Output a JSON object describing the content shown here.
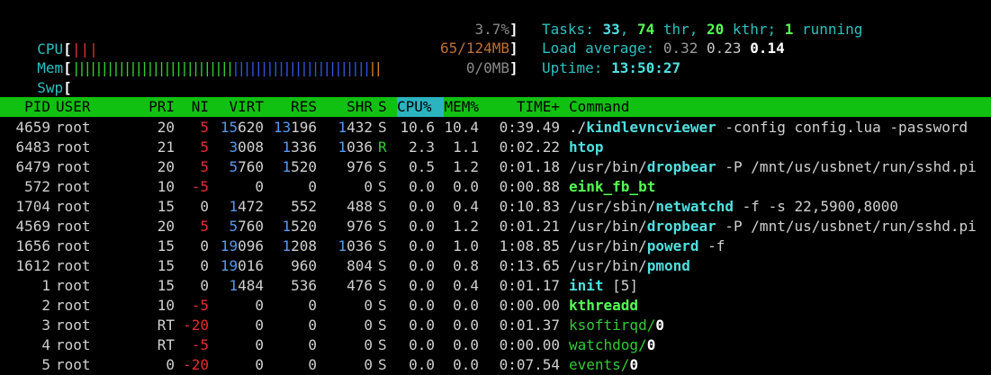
{
  "meters": {
    "cpu": {
      "label": "CPU",
      "bar": "|||",
      "value": "3.7%",
      "percent": 3.7
    },
    "mem": {
      "label": "Mem",
      "bar_green": "||||||||||||||||||||||||||||",
      "bar_blue": "||||||||||||||||||||||||",
      "bar_orange": "||",
      "value": "65/124MB"
    },
    "swp": {
      "label": "Swp",
      "value": "0/0MB"
    },
    "open_bracket": "[",
    "close_bracket": "]"
  },
  "summary": {
    "tasks_label": "Tasks: ",
    "tasks": "33",
    "sep1": ", ",
    "threads": "74",
    "thr_label": " thr, ",
    "kthreads": "20",
    "kthr_label": " kthr; ",
    "running": "1",
    "running_label": " running",
    "load_label": "Load average: ",
    "load1": "0.32",
    "load5": "0.23",
    "load15": "0.14",
    "uptime_label": "Uptime: ",
    "uptime": "13:50:27"
  },
  "columns": {
    "pid": "PID",
    "user": "USER",
    "pri": "PRI",
    "ni": "NI",
    "virt": "VIRT",
    "res": "RES",
    "shr": "SHR",
    "s": "S",
    "cpu": "CPU%",
    "mem": "MEM%",
    "time": "TIME+",
    "command": "Command"
  },
  "processes": [
    {
      "pid": "4659",
      "user": "root",
      "pri": "20",
      "ni": "5",
      "virt_hi": "15",
      "virt_lo": "620",
      "res_hi": "13",
      "res_lo": "196",
      "shr_hi": "1",
      "shr_lo": "432",
      "s": "S",
      "cpu": "10.6",
      "mem": "10.4",
      "time": "0:39.49",
      "cmd_pre": "./",
      "cmd_bin": "kindlevncviewer",
      "cmd_args": " -config config.lua -password"
    },
    {
      "pid": "6483",
      "user": "root",
      "pri": "21",
      "ni": "5",
      "virt_hi": "3",
      "virt_lo": "008",
      "res_hi": "1",
      "res_lo": "336",
      "shr_hi": "1",
      "shr_lo": "036",
      "s": "R",
      "cpu": "2.3",
      "mem": "1.1",
      "time": "0:02.22",
      "cmd_pre": "",
      "cmd_bin": "htop",
      "cmd_args": ""
    },
    {
      "pid": "6479",
      "user": "root",
      "pri": "20",
      "ni": "5",
      "virt_hi": "5",
      "virt_lo": "760",
      "res_hi": "1",
      "res_lo": "520",
      "shr_hi": "",
      "shr_lo": "976",
      "s": "S",
      "cpu": "0.5",
      "mem": "1.2",
      "time": "0:01.18",
      "cmd_pre": "/usr/bin/",
      "cmd_bin": "dropbear",
      "cmd_args": " -P /mnt/us/usbnet/run/sshd.pi"
    },
    {
      "pid": "572",
      "user": "root",
      "pri": "10",
      "ni": "-5",
      "virt_hi": "",
      "virt_lo": "0",
      "res_hi": "",
      "res_lo": "0",
      "shr_hi": "",
      "shr_lo": "0",
      "s": "S",
      "cpu": "0.0",
      "mem": "0.0",
      "time": "0:00.88",
      "cmd_pre": "",
      "cmd_bin": "eink_fb_bt",
      "cmd_args": ""
    },
    {
      "pid": "1704",
      "user": "root",
      "pri": "15",
      "ni": "0",
      "virt_hi": "1",
      "virt_lo": "472",
      "res_hi": "",
      "res_lo": "552",
      "shr_hi": "",
      "shr_lo": "488",
      "s": "S",
      "cpu": "0.0",
      "mem": "0.4",
      "time": "0:10.83",
      "cmd_pre": "/usr/sbin/",
      "cmd_bin": "netwatchd",
      "cmd_args": " -f -s 22,5900,8000"
    },
    {
      "pid": "4569",
      "user": "root",
      "pri": "20",
      "ni": "5",
      "virt_hi": "5",
      "virt_lo": "760",
      "res_hi": "1",
      "res_lo": "520",
      "shr_hi": "",
      "shr_lo": "976",
      "s": "S",
      "cpu": "0.0",
      "mem": "1.2",
      "time": "0:01.21",
      "cmd_pre": "/usr/bin/",
      "cmd_bin": "dropbear",
      "cmd_args": " -P /mnt/us/usbnet/run/sshd.pi"
    },
    {
      "pid": "1656",
      "user": "root",
      "pri": "15",
      "ni": "0",
      "virt_hi": "19",
      "virt_lo": "096",
      "res_hi": "1",
      "res_lo": "208",
      "shr_hi": "1",
      "shr_lo": "036",
      "s": "S",
      "cpu": "0.0",
      "mem": "1.0",
      "time": "1:08.85",
      "cmd_pre": "/usr/bin/",
      "cmd_bin": "powerd",
      "cmd_args": " -f"
    },
    {
      "pid": "1612",
      "user": "root",
      "pri": "15",
      "ni": "0",
      "virt_hi": "19",
      "virt_lo": "016",
      "res_hi": "",
      "res_lo": "960",
      "shr_hi": "",
      "shr_lo": "804",
      "s": "S",
      "cpu": "0.0",
      "mem": "0.8",
      "time": "0:13.65",
      "cmd_pre": "/usr/bin/",
      "cmd_bin": "pmond",
      "cmd_args": ""
    },
    {
      "pid": "1",
      "user": "root",
      "pri": "15",
      "ni": "0",
      "virt_hi": "1",
      "virt_lo": "484",
      "res_hi": "",
      "res_lo": "536",
      "shr_hi": "",
      "shr_lo": "476",
      "s": "S",
      "cpu": "0.0",
      "mem": "0.4",
      "time": "0:01.17",
      "cmd_pre": "",
      "cmd_bin": "init",
      "cmd_args": " [5]"
    },
    {
      "pid": "2",
      "user": "root",
      "pri": "10",
      "ni": "-5",
      "virt_hi": "",
      "virt_lo": "0",
      "res_hi": "",
      "res_lo": "0",
      "shr_hi": "",
      "shr_lo": "0",
      "s": "S",
      "cpu": "0.0",
      "mem": "0.0",
      "time": "0:00.00",
      "cmd_pre": "",
      "cmd_bin": "kthreadd",
      "cmd_args": ""
    },
    {
      "pid": "3",
      "user": "root",
      "pri": "RT",
      "ni": "-20",
      "virt_hi": "",
      "virt_lo": "0",
      "res_hi": "",
      "res_lo": "0",
      "shr_hi": "",
      "shr_lo": "0",
      "s": "S",
      "cpu": "0.0",
      "mem": "0.0",
      "time": "0:01.37",
      "cmd_pre": "",
      "cmd_bin": "ksoftirqd/",
      "cmd_args": "0",
      "kthread": true
    },
    {
      "pid": "4",
      "user": "root",
      "pri": "RT",
      "ni": "-5",
      "virt_hi": "",
      "virt_lo": "0",
      "res_hi": "",
      "res_lo": "0",
      "shr_hi": "",
      "shr_lo": "0",
      "s": "S",
      "cpu": "0.0",
      "mem": "0.0",
      "time": "0:00.00",
      "cmd_pre": "",
      "cmd_bin": "watchdog/",
      "cmd_args": "0",
      "kthread": true
    },
    {
      "pid": "5",
      "user": "root",
      "pri": "0",
      "ni": "-20",
      "virt_hi": "",
      "virt_lo": "0",
      "res_hi": "",
      "res_lo": "0",
      "shr_hi": "",
      "shr_lo": "0",
      "s": "S",
      "cpu": "0.0",
      "mem": "0.0",
      "time": "0:07.54",
      "cmd_pre": "",
      "cmd_bin": "events/",
      "cmd_args": "0",
      "kthread": true
    }
  ],
  "colors": {
    "header_bg": "#11c111",
    "sort_column_bg": "#2bb3c0",
    "label_cyan": "#2bc0c0",
    "nice_red": "#e03030",
    "thousands_blue": "#5599ee",
    "running_green": "#33cc33"
  }
}
